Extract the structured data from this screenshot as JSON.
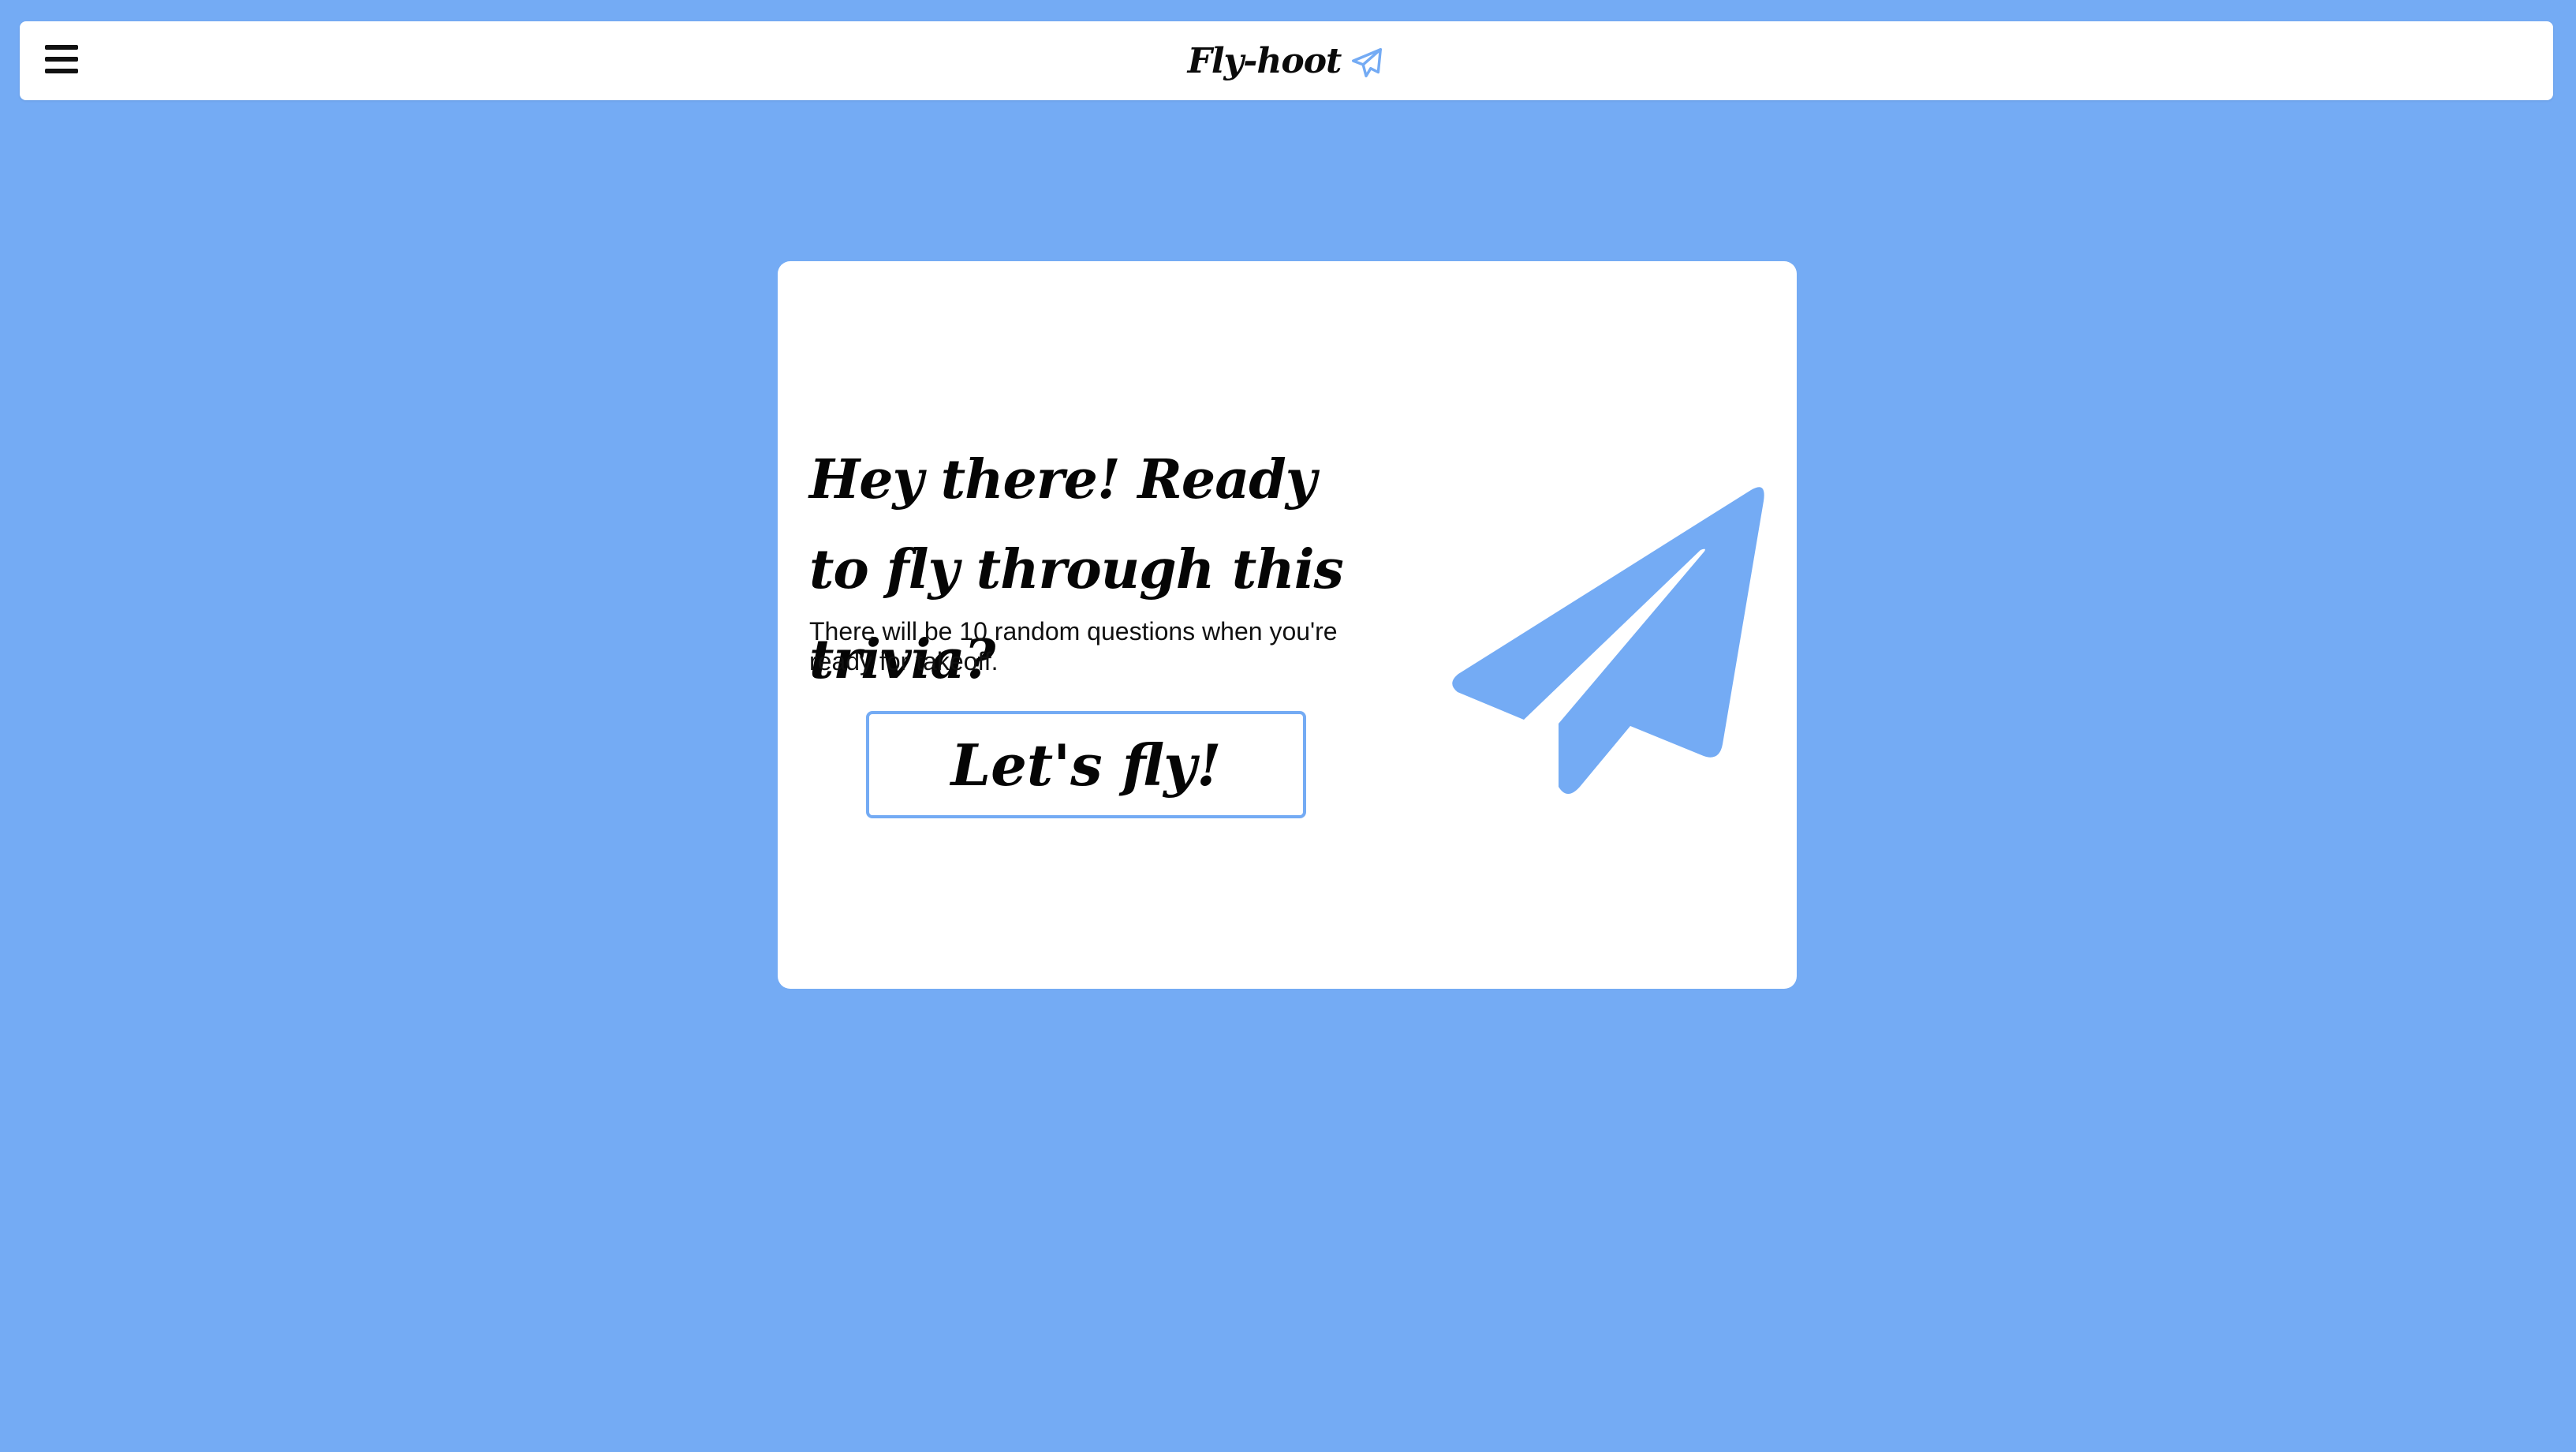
{
  "navbar": {
    "brand_name": "Fly-hoot",
    "menu_icon": "hamburger-menu-icon",
    "brand_icon": "paper-plane-outline-icon"
  },
  "card": {
    "headline": "Hey there! Ready to fly through this trivia?",
    "description": "There will be 10 random questions when you're ready for takeoff.",
    "start_button_label": "Let's fly!",
    "illustration_icon": "paper-plane-icon"
  },
  "colors": {
    "background": "#74abf4",
    "surface": "#ffffff",
    "accent": "#74abf4",
    "text": "#050505"
  }
}
